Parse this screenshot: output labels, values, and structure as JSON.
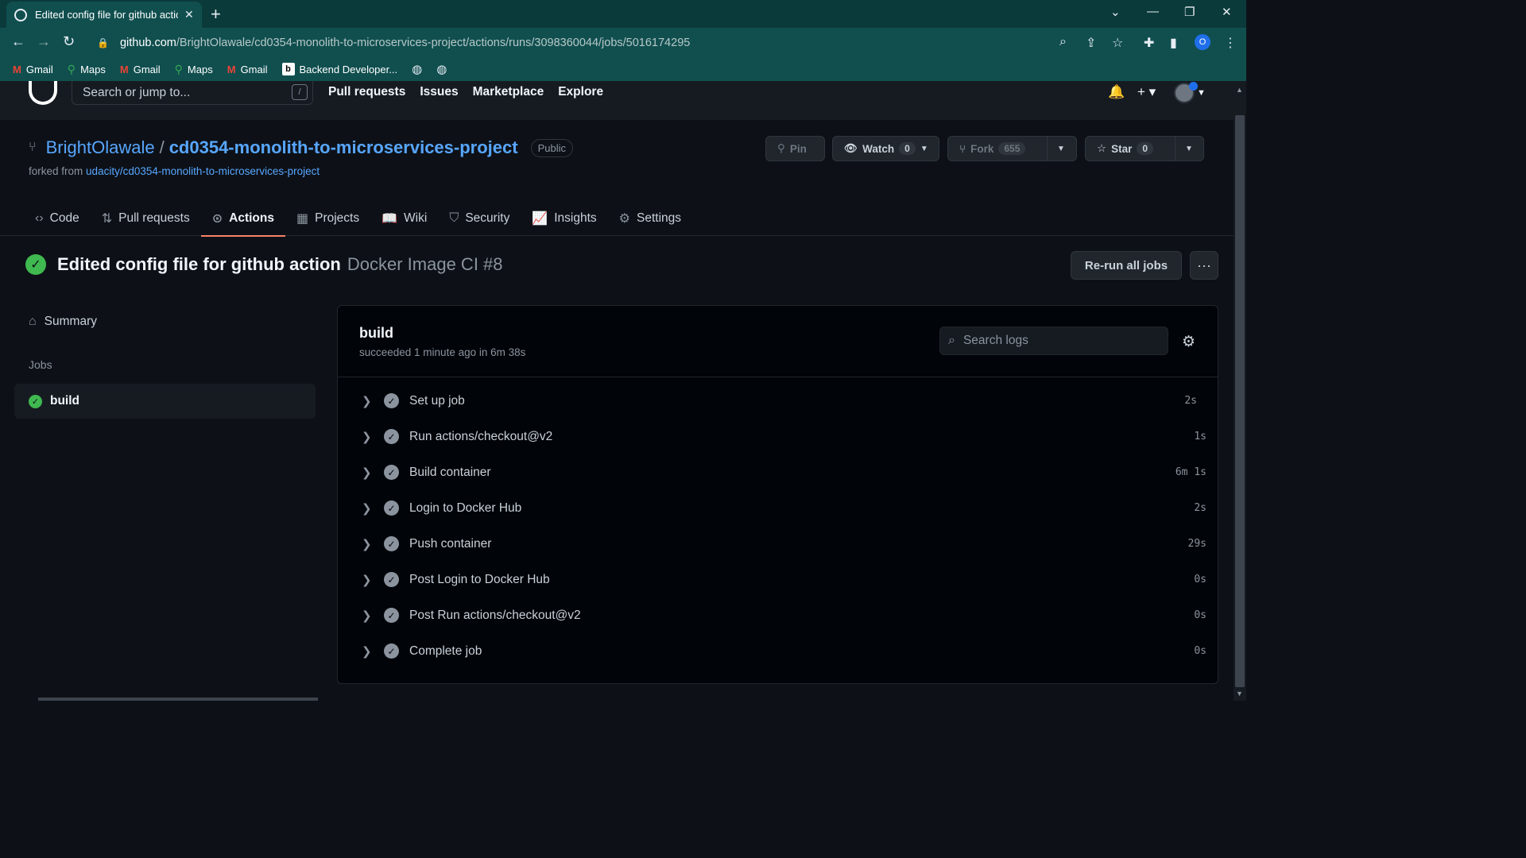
{
  "browser": {
    "tab_title": "Edited config file for github actio",
    "url_host": "github.com",
    "url_path": "/BrightOlawale/cd0354-monolith-to-microservices-project/actions/runs/3098360044/jobs/5016174295",
    "profile_letter": "O",
    "bookmarks": [
      {
        "label": "Gmail",
        "icon": "gmail-icon"
      },
      {
        "label": "Maps",
        "icon": "maps-icon"
      },
      {
        "label": "Gmail",
        "icon": "gmail-icon"
      },
      {
        "label": "Maps",
        "icon": "maps-icon"
      },
      {
        "label": "Gmail",
        "icon": "gmail-icon"
      },
      {
        "label": "Backend Developer...",
        "icon": "b-icon"
      }
    ]
  },
  "header": {
    "search_placeholder": "Search or jump to...",
    "search_shortcut": "/",
    "nav": [
      "Pull requests",
      "Issues",
      "Marketplace",
      "Explore"
    ]
  },
  "repo": {
    "owner": "BrightOlawale",
    "separator": "/",
    "name": "cd0354-monolith-to-microservices-project",
    "visibility": "Public",
    "forked_prefix": "forked from",
    "forked_from": "udacity/cd0354-monolith-to-microservices-project",
    "pin_label": "Pin",
    "watch_label": "Watch",
    "watch_count": "0",
    "fork_label": "Fork",
    "fork_count": "655",
    "star_label": "Star",
    "star_count": "0",
    "tabs": [
      {
        "label": "Code",
        "icon": "code-icon"
      },
      {
        "label": "Pull requests",
        "icon": "pull-request-icon"
      },
      {
        "label": "Actions",
        "icon": "play-icon",
        "active": true
      },
      {
        "label": "Projects",
        "icon": "table-icon"
      },
      {
        "label": "Wiki",
        "icon": "book-icon"
      },
      {
        "label": "Security",
        "icon": "shield-icon"
      },
      {
        "label": "Insights",
        "icon": "graph-icon"
      },
      {
        "label": "Settings",
        "icon": "gear-icon"
      }
    ]
  },
  "run": {
    "title": "Edited config file for github action",
    "workflow": "Docker Image CI #8",
    "rerun_label": "Re-run all jobs",
    "more_label": "···"
  },
  "sidebar": {
    "summary_label": "Summary",
    "jobs_label": "Jobs",
    "job_name": "build"
  },
  "job": {
    "name": "build",
    "status": "succeeded 1 minute ago in 6m 38s",
    "search_placeholder": "Search logs",
    "steps": [
      {
        "label": "Set up job",
        "duration": "2s"
      },
      {
        "label": "Run actions/checkout@v2",
        "duration": "1s"
      },
      {
        "label": "Build container",
        "duration": "6m 1s"
      },
      {
        "label": "Login to Docker Hub",
        "duration": "2s"
      },
      {
        "label": "Push container",
        "duration": "29s"
      },
      {
        "label": "Post Login to Docker Hub",
        "duration": "0s"
      },
      {
        "label": "Post Run actions/checkout@v2",
        "duration": "0s"
      },
      {
        "label": "Complete job",
        "duration": "0s"
      }
    ]
  },
  "colors": {
    "success": "#3fb950",
    "link": "#58a6ff",
    "active_tab_underline": "#f78166",
    "browser_frame": "#114f4f"
  }
}
